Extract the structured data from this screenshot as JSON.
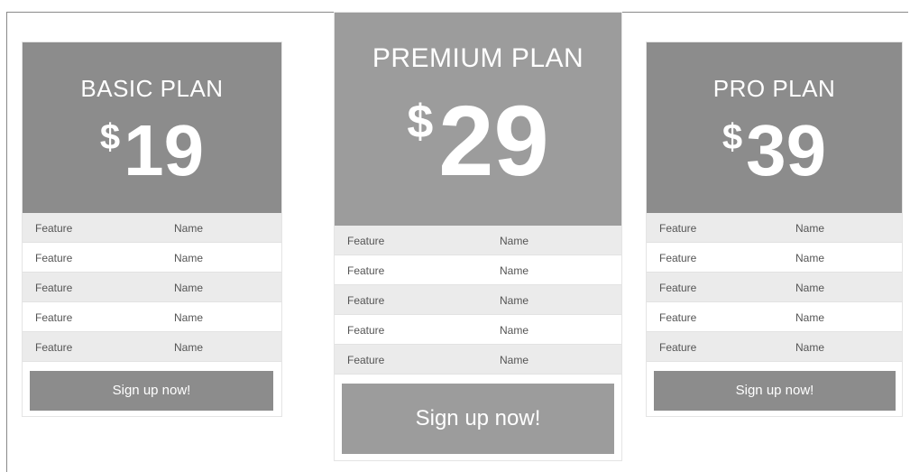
{
  "colors": {
    "header_gray": "#8c8c8c",
    "premium_gray": "#9c9c9c",
    "row_alt": "#ebebeb",
    "text_on_header": "#ffffff"
  },
  "plans": {
    "basic": {
      "title": "BASIC PLAN",
      "currency": "$",
      "price": "19",
      "features": [
        {
          "label": "Feature",
          "value": "Name"
        },
        {
          "label": "Feature",
          "value": "Name"
        },
        {
          "label": "Feature",
          "value": "Name"
        },
        {
          "label": "Feature",
          "value": "Name"
        },
        {
          "label": "Feature",
          "value": "Name"
        }
      ],
      "cta": "Sign up now!"
    },
    "premium": {
      "title": "PREMIUM PLAN",
      "currency": "$",
      "price": "29",
      "features": [
        {
          "label": "Feature",
          "value": "Name"
        },
        {
          "label": "Feature",
          "value": "Name"
        },
        {
          "label": "Feature",
          "value": "Name"
        },
        {
          "label": "Feature",
          "value": "Name"
        },
        {
          "label": "Feature",
          "value": "Name"
        }
      ],
      "cta": "Sign up now!"
    },
    "pro": {
      "title": "PRO PLAN",
      "currency": "$",
      "price": "39",
      "features": [
        {
          "label": "Feature",
          "value": "Name"
        },
        {
          "label": "Feature",
          "value": "Name"
        },
        {
          "label": "Feature",
          "value": "Name"
        },
        {
          "label": "Feature",
          "value": "Name"
        },
        {
          "label": "Feature",
          "value": "Name"
        }
      ],
      "cta": "Sign up now!"
    }
  }
}
